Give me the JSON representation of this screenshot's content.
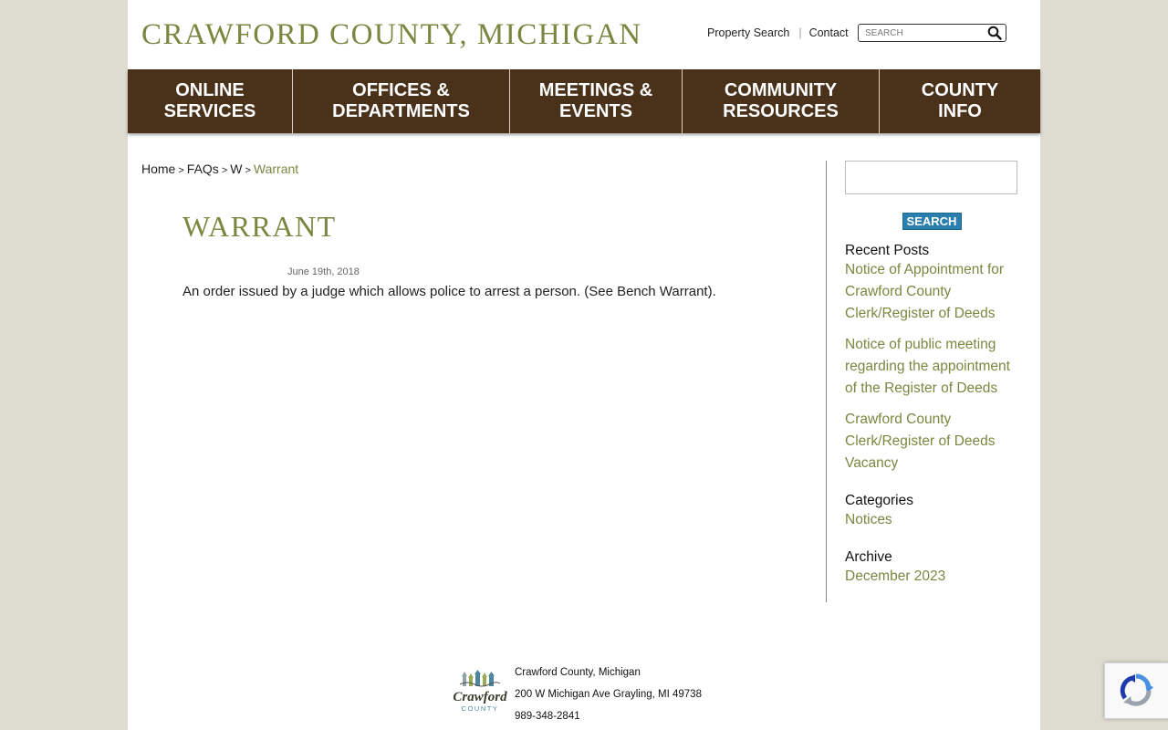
{
  "header": {
    "site_title": "CRAWFORD COUNTY, MICHIGAN",
    "links": [
      "Property Search",
      "Contact"
    ],
    "search_placeholder": "SEARCH"
  },
  "nav": {
    "items": [
      {
        "line1": "ONLINE",
        "line2": "SERVICES"
      },
      {
        "line1": "OFFICES &",
        "line2": "DEPARTMENTS"
      },
      {
        "line1": "MEETINGS &",
        "line2": "EVENTS"
      },
      {
        "line1": "COMMUNITY",
        "line2": "RESOURCES"
      },
      {
        "line1": "COUNTY",
        "line2": "INFO"
      }
    ]
  },
  "breadcrumb": {
    "items": [
      "Home",
      "FAQs",
      "W"
    ],
    "separator": ">",
    "current": "Warrant"
  },
  "post": {
    "title": "Warrant",
    "date": "June 19th, 2018",
    "body": "An order issued by a judge which allows police to arrest a person. (See Bench Warrant)."
  },
  "sidebar": {
    "search_button": "SEARCH",
    "recent_posts_title": "Recent Posts",
    "recent_posts": [
      "Notice of Appointment for Crawford County Clerk/Register of Deeds",
      "Notice of public meeting regarding the appointment of the Register of Deeds",
      "Crawford County Clerk/Register of Deeds Vacancy"
    ],
    "categories_title": "Categories",
    "categories": [
      "Notices"
    ],
    "archive_title": "Archive",
    "archive": [
      "December 2023"
    ]
  },
  "footer": {
    "logo_text": "Crawford COUNTY",
    "name": "Crawford County, Michigan",
    "address": "200 W Michigan Ave Grayling, MI 49738",
    "phone": "989-348-2841"
  },
  "colors": {
    "accent_green": "#7a8740",
    "nav_brown": "#4a311a",
    "button_blue": "#2a7fae",
    "page_bg": "#dedbd1"
  }
}
